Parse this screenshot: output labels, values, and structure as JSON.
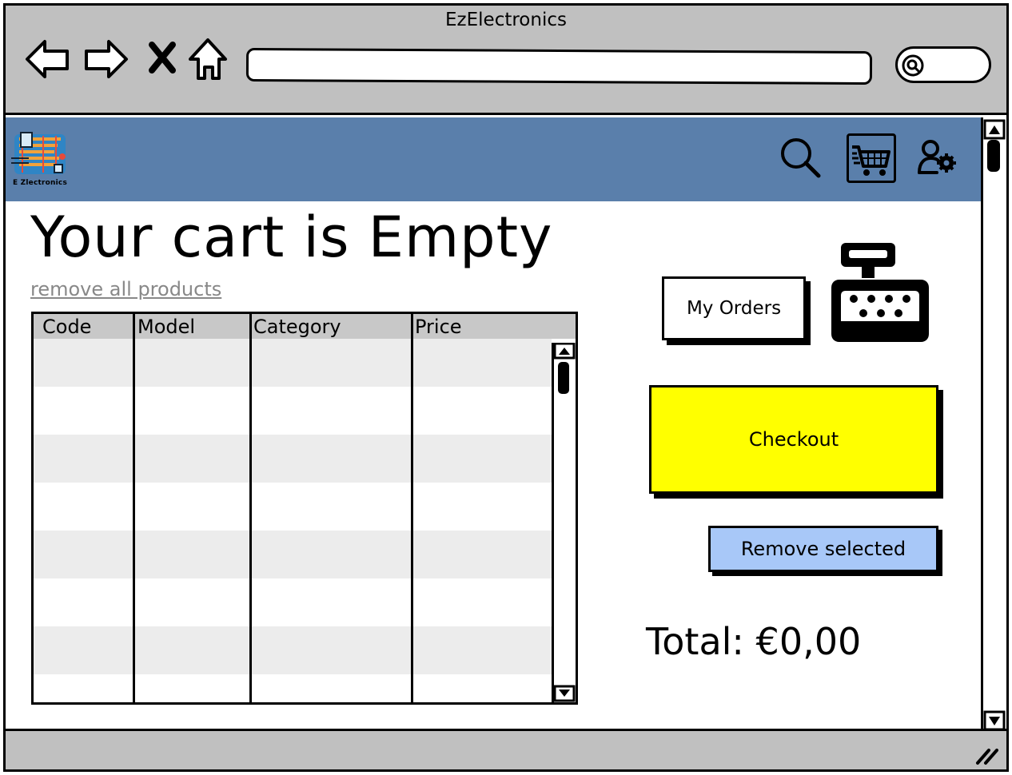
{
  "window": {
    "title": "EzElectronics"
  },
  "logo": {
    "text": "E Zlectronics"
  },
  "page": {
    "heading": "Your cart is Empty",
    "remove_all_link": "remove all products"
  },
  "table": {
    "columns": [
      "Code",
      "Model",
      "Category",
      "Price"
    ],
    "rows": []
  },
  "actions": {
    "my_orders": "My Orders",
    "checkout": "Checkout",
    "remove_selected": "Remove selected"
  },
  "total": {
    "text": "Total: €0,00"
  },
  "colors": {
    "header_bar": "#5a7fab",
    "checkout": "#ffff00",
    "remove_selected": "#a8c8f8",
    "chrome": "#c0c0c0"
  }
}
